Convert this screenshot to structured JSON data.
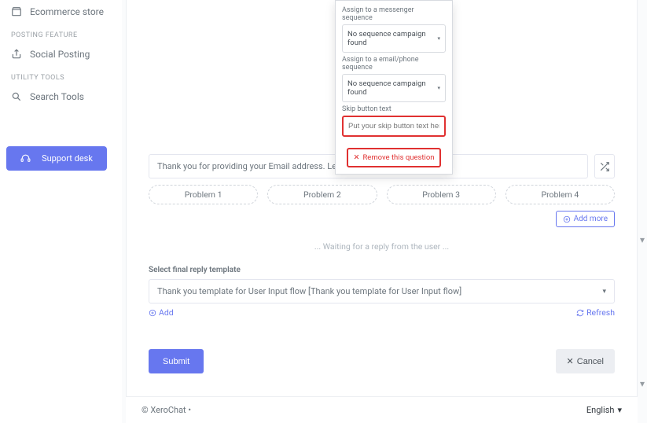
{
  "sidebar": {
    "ecommerce": "Ecommerce store",
    "posting_header": "POSTING FEATURE",
    "social": "Social Posting",
    "utility_header": "UTILITY TOOLS",
    "search": "Search Tools",
    "support": "Support desk"
  },
  "popup": {
    "assign_messenger_label": "Assign to a messenger sequence",
    "messenger_value": "No sequence campaign found",
    "assign_email_label": "Assign to a email/phone sequence",
    "email_value": "No sequence campaign found",
    "skip_label": "Skip button text",
    "skip_placeholder": "Put your skip button text here",
    "remove_label": "Remove this question"
  },
  "main": {
    "message_value": "Thank you for providing your Email address. Let us know your Problem",
    "problems": [
      "Problem 1",
      "Problem 2",
      "Problem 3",
      "Problem 4"
    ],
    "add_more_label": "Add more",
    "waiting_text": "... Waiting for a reply from the user ...",
    "template_section_label": "Select final reply template",
    "template_value": "Thank you template for User Input flow [Thank you template for User Input flow]",
    "add_link": "Add",
    "refresh_link": "Refresh",
    "submit_label": "Submit",
    "cancel_label": "Cancel"
  },
  "footer": {
    "copyright": "© XeroChat  •",
    "language": "English"
  }
}
